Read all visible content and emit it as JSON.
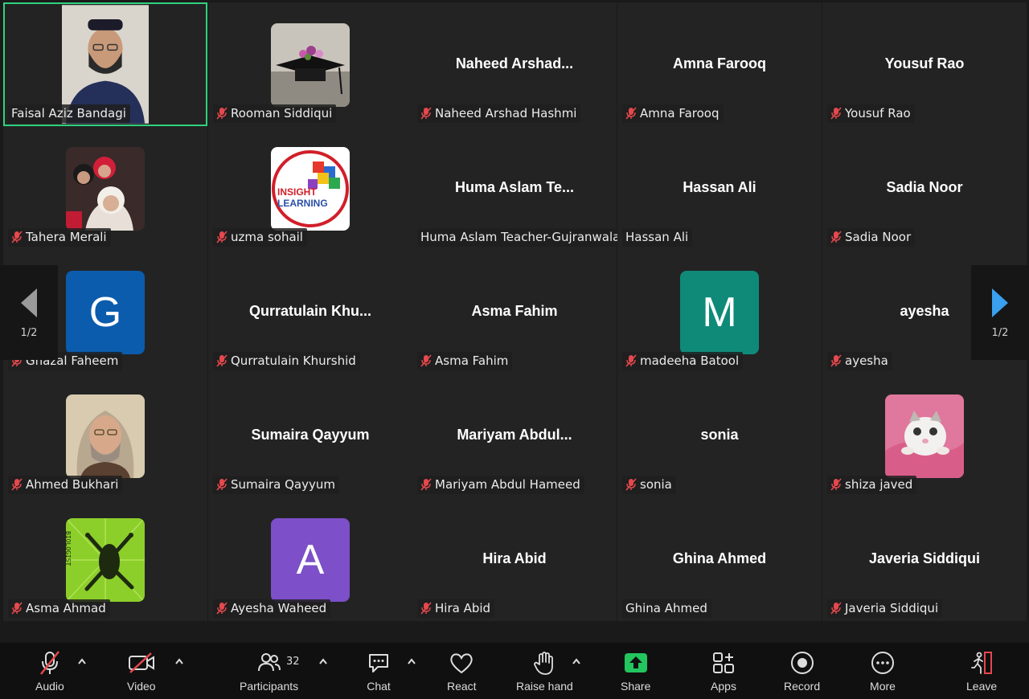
{
  "pager": {
    "left_label": "1/2",
    "right_label": "1/2"
  },
  "tiles": [
    {
      "name": "Faisal Aziz Bandagi",
      "muted": false,
      "avatar": "photo-man",
      "active": true
    },
    {
      "name": "Rooman Siddiqui",
      "muted": true,
      "avatar": "photo-graduation-cap"
    },
    {
      "name": "Naheed Arshad Hashmi",
      "display": "Naheed  Arshad...",
      "muted": true
    },
    {
      "name": "Amna Farooq",
      "display": "Amna Farooq",
      "muted": true
    },
    {
      "name": "Yousuf Rao",
      "display": "Yousuf Rao",
      "muted": true
    },
    {
      "name": "Tahera Merali",
      "muted": true,
      "avatar": "photo-family"
    },
    {
      "name": "uzma sohail",
      "muted": true,
      "avatar": "logo-insight-learning"
    },
    {
      "name": "Huma Aslam Teacher-Gujranwala...",
      "display": "Huma Aslam  Te...",
      "muted": false
    },
    {
      "name": "Hassan Ali",
      "display": "Hassan Ali",
      "muted": false
    },
    {
      "name": "Sadia Noor",
      "display": "Sadia Noor",
      "muted": true
    },
    {
      "name": "Ghazal Faheem",
      "muted": true,
      "letter": "G",
      "letter_color": "#0b5cad"
    },
    {
      "name": "Qurratulain Khurshid",
      "display": "Qurratulain  Khu...",
      "muted": true
    },
    {
      "name": "Asma Fahim",
      "display": "Asma Fahim",
      "muted": true
    },
    {
      "name": "madeeha Batool",
      "muted": true,
      "letter": "M",
      "letter_color": "#0f8a78"
    },
    {
      "name": "ayesha",
      "display": "ayesha",
      "muted": true
    },
    {
      "name": "Ahmed Bukhari",
      "muted": true,
      "avatar": "photo-elder-man"
    },
    {
      "name": "Sumaira Qayyum",
      "display": "Sumaira Qayyum",
      "muted": true
    },
    {
      "name": "Mariyam Abdul Hameed",
      "display": "Mariyam  Abdul...",
      "muted": true
    },
    {
      "name": "sonia",
      "display": "sonia",
      "muted": true
    },
    {
      "name": "shiza javed",
      "muted": true,
      "avatar": "photo-kitten"
    },
    {
      "name": "Asma Ahmad",
      "muted": true,
      "avatar": "logo-biologist-frog"
    },
    {
      "name": "Ayesha Waheed",
      "muted": true,
      "letter": "A",
      "letter_color": "#7d4fc9"
    },
    {
      "name": "Hira Abid",
      "display": "Hira Abid",
      "muted": true
    },
    {
      "name": "Ghina Ahmed",
      "display": "Ghina Ahmed",
      "muted": false
    },
    {
      "name": "Javeria Siddiqui",
      "display": "Javeria Siddiqui",
      "muted": true
    }
  ],
  "toolbar": {
    "audio": "Audio",
    "video": "Video",
    "participants": "Participants",
    "participants_count": "32",
    "chat": "Chat",
    "react": "React",
    "raise_hand": "Raise hand",
    "share": "Share",
    "apps": "Apps",
    "record": "Record",
    "more": "More",
    "leave": "Leave"
  },
  "colors": {
    "active_border": "#2fd27f",
    "share_green": "#22c55e",
    "mute_red": "#e5484d",
    "leave_red": "#e5484d",
    "arrow_blue": "#3aa0f0"
  }
}
